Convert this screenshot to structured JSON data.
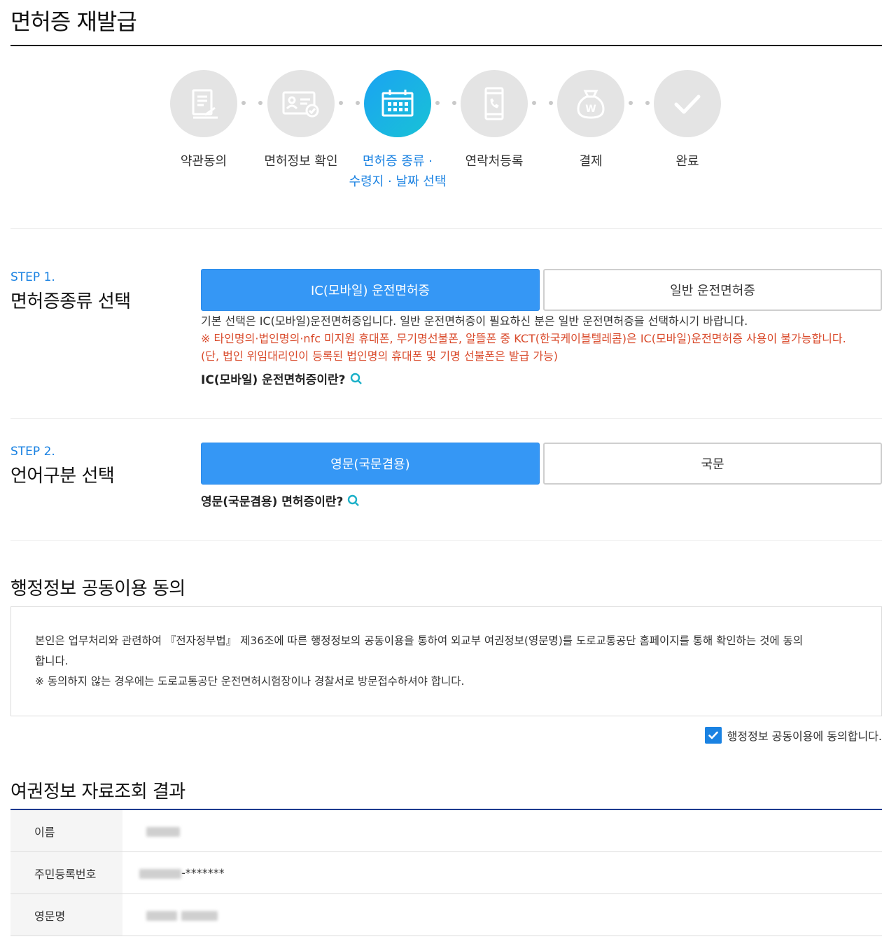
{
  "page": {
    "title": "면허증 재발급"
  },
  "stepper": {
    "steps": [
      {
        "label": "약관동의",
        "icon": "document-sign-icon",
        "active": false
      },
      {
        "label": "면허정보 확인",
        "icon": "id-card-check-icon",
        "active": false
      },
      {
        "label_line1": "면허증 종류 ·",
        "label_line2": "수령지 · 날짜 선택",
        "icon": "calendar-icon",
        "active": true
      },
      {
        "label": "연락처등록",
        "icon": "phone-icon",
        "active": false
      },
      {
        "label": "결제",
        "icon": "money-bag-icon",
        "active": false
      },
      {
        "label": "완료",
        "icon": "checkmark-icon",
        "active": false
      }
    ],
    "active_color": "#1aa3f2"
  },
  "step1": {
    "tag": "STEP 1.",
    "heading": "면허증종류 선택",
    "options": [
      "IC(모바일) 운전면허증",
      "일반 운전면허증"
    ],
    "selected": "IC(모바일) 운전면허증",
    "desc_line1": "기본 선택은 IC(모바일)운전면허증입니다. 일반 운전면허증이 필요하신 분은 일반 운전면허증을 선택하시기 바랍니다.",
    "warning_line1": "※ 타인명의·법인명의·nfc 미지원 휴대폰, 무기명선불폰, 알뜰폰 중 KCT(한국케이블텔레콤)은 IC(모바일)운전면허증 사용이 불가능합니다.",
    "warning_line2": "(단, 법인 위임대리인이 등록된 법인명의 휴대폰 및 기명 선불폰은 발급 가능)",
    "help_link": "IC(모바일) 운전면허증이란?"
  },
  "step2": {
    "tag": "STEP 2.",
    "heading": "언어구분 선택",
    "options": [
      "영문(국문겸용)",
      "국문"
    ],
    "selected": "영문(국문겸용)",
    "help_link": "영문(국문겸용) 면허증이란?"
  },
  "consent": {
    "title": "행정정보 공동이용 동의",
    "text_line1": "본인은 업무처리와 관련하여 『전자정부법』 제36조에 따른 행정정보의 공동이용을 통하여 외교부 여권정보(영문명)를 도로교통공단 홈페이지를 통해 확인하는 것에 동의",
    "text_line2": "합니다.",
    "text_line3": "※ 동의하지 않는 경우에는 도로교통공단 운전면허시험장이나 경찰서로 방문접수하셔야 합니다.",
    "checkbox_label": "행정정보 공동이용에 동의합니다.",
    "checked": true
  },
  "passport": {
    "title": "여권정보 자료조회 결과",
    "rows": [
      {
        "label": "이름",
        "value": ""
      },
      {
        "label": "주민등록번호",
        "value_suffix": "-*******"
      },
      {
        "label": "영문명",
        "value": ""
      }
    ]
  },
  "colors": {
    "primary": "#3597f5",
    "accent_text": "#1a82e2",
    "warning": "#d94a2b",
    "table_rule": "#1d3a8f"
  }
}
